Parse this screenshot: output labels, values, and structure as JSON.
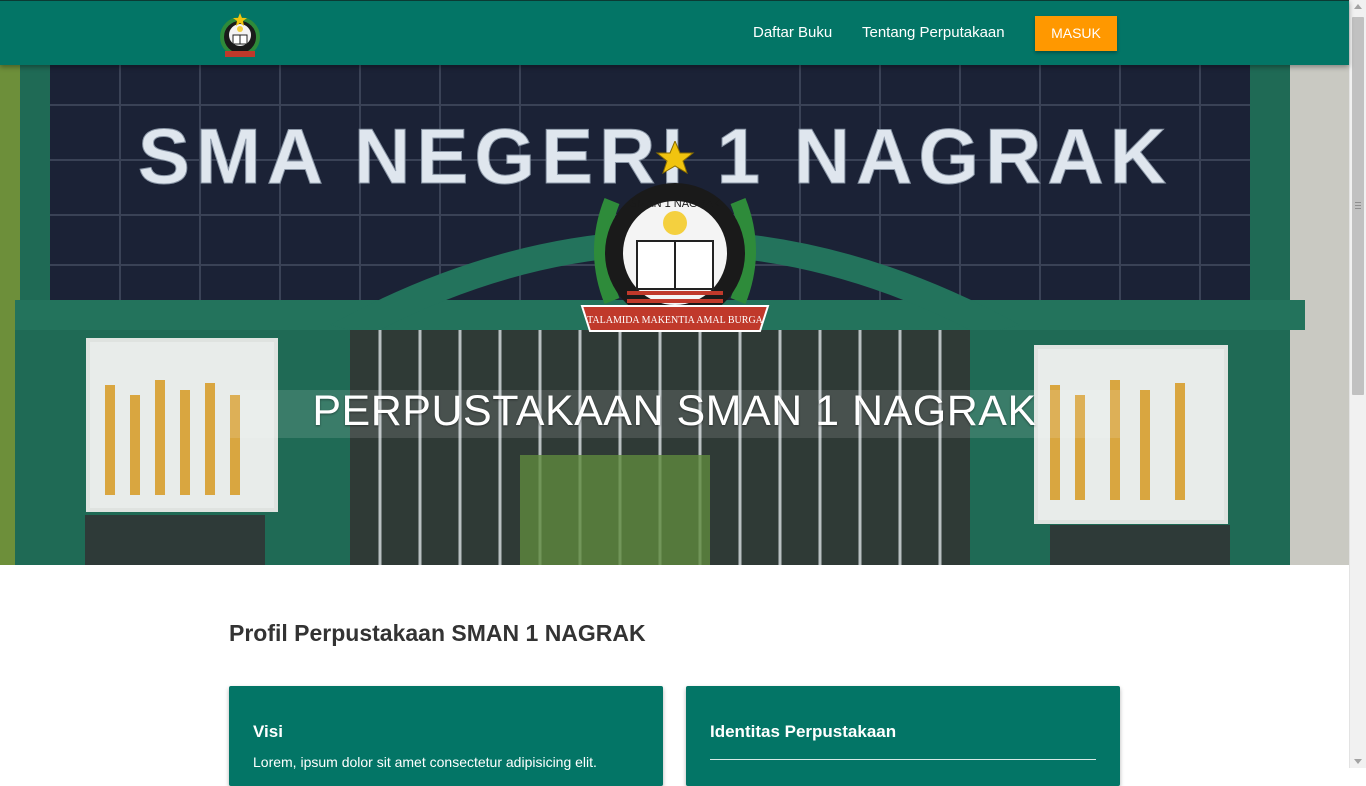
{
  "nav": {
    "links": [
      "Daftar Buku",
      "Tentang Perputakaan"
    ],
    "login_label": "MASUK",
    "logo_icon": "school-emblem-icon"
  },
  "hero": {
    "sign_text": "SMA NEGERI 1 NAGRAK",
    "title": "PERPUSTAKAAN SMAN 1 NAGRAK",
    "emblem": {
      "arc_text": "SMAN 1 NAGRAK",
      "ribbon_text": "TALAMIDA MAKENTIA AMAL BURGA"
    }
  },
  "profile": {
    "heading": "Profil Perpustakaan SMAN 1 NAGRAK",
    "cards": [
      {
        "title": "Visi",
        "text": "Lorem, ipsum dolor sit amet consectetur adipisicing elit."
      },
      {
        "title": "Identitas Perpustakaan"
      }
    ]
  },
  "colors": {
    "primary": "#037566",
    "accent": "#ff9800",
    "text": "#333333"
  }
}
